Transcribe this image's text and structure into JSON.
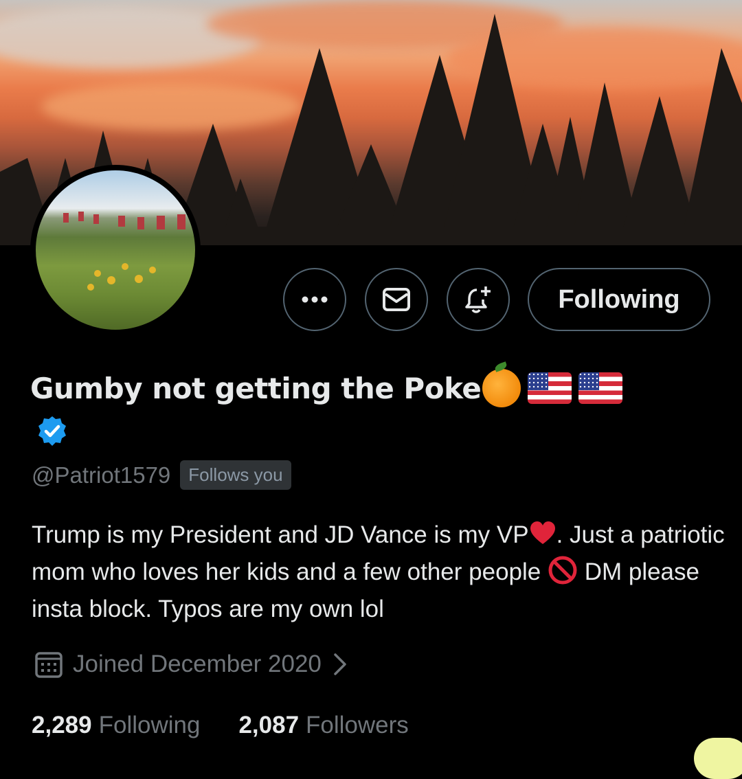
{
  "profile": {
    "display_name": "Gumby not getting the Poke",
    "name_emojis": [
      "orange-emoji",
      "us-flag-emoji",
      "us-flag-emoji"
    ],
    "verified": true,
    "handle": "@Patriot1579",
    "follows_you_badge": "Follows you",
    "bio_part1": "Trump is my President and JD Vance is my VP",
    "bio_part2": ". Just a patriotic mom who loves her kids and a few other people ",
    "bio_part3": " DM please insta block. Typos are my own lol",
    "joined": "Joined December 2020",
    "following_count": "2,289",
    "following_label": "Following",
    "followers_count": "2,087",
    "followers_label": "Followers"
  },
  "actions": {
    "more_icon": "more-horizontal-icon",
    "message_icon": "mail-icon",
    "notify_icon": "bell-plus-icon",
    "following_button": "Following"
  },
  "colors": {
    "background": "#000000",
    "text_primary": "#e7e9ea",
    "text_secondary": "#71767b",
    "verified_blue": "#1d9bf0",
    "border": "#536471"
  }
}
